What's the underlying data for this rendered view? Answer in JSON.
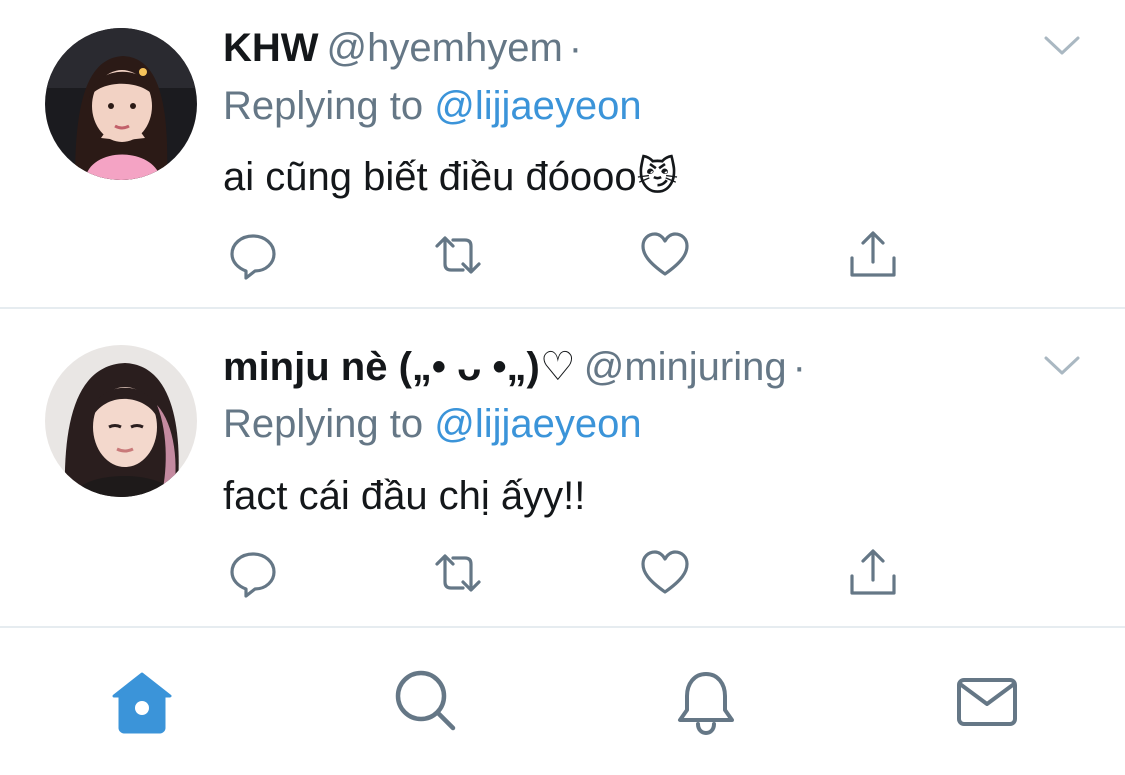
{
  "tweets": [
    {
      "display_name": "KHW",
      "handle": "@hyemhyem",
      "dot": "·",
      "replying_prefix": "Replying to",
      "replying_to": "@lijjaeyeon",
      "text": "ai cũng biết điều đóooo😼"
    },
    {
      "display_name": "minju nè („• ᴗ •„)♡",
      "handle": "@minjuring",
      "dot": "·",
      "replying_prefix": "Replying to",
      "replying_to": "@lijjaeyeon",
      "text": "fact cái đầu chị ấyy!!"
    }
  ],
  "actions": [
    "reply-icon",
    "retweet-icon",
    "like-icon",
    "share-icon"
  ],
  "tabbar": {
    "items": [
      "home-icon",
      "search-icon",
      "notifications-icon",
      "messages-icon"
    ],
    "active": "home-icon"
  },
  "colors": {
    "text": "#14171a",
    "secondary": "#657786",
    "link": "#3b94d9",
    "icon": "#657786",
    "active_tab": "#3b94d9",
    "divider": "#e6ecf0"
  }
}
